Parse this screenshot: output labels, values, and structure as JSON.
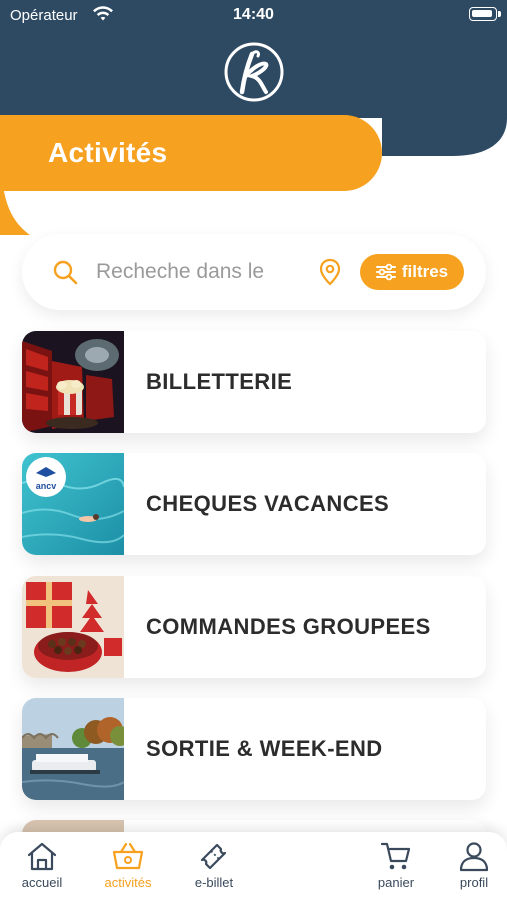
{
  "status_bar": {
    "carrier": "Opérateur",
    "time": "14:40"
  },
  "header": {
    "title": "Activités"
  },
  "search": {
    "placeholder": "Recheche dans le",
    "filter_label": "filtres"
  },
  "categories": [
    {
      "label": "BILLETTERIE"
    },
    {
      "label": "CHEQUES VACANCES",
      "thumb_text": "ancv"
    },
    {
      "label": "COMMANDES GROUPEES"
    },
    {
      "label": "SORTIE & WEEK-END"
    }
  ],
  "tabbar": {
    "items": [
      {
        "label": "accueil",
        "icon": "home-icon"
      },
      {
        "label": "activités",
        "icon": "basket-icon",
        "active": true
      },
      {
        "label": "e-billet",
        "icon": "ticket-icon"
      },
      {
        "label": "panier",
        "icon": "cart-icon"
      },
      {
        "label": "profil",
        "icon": "user-icon"
      }
    ]
  },
  "colors": {
    "navy": "#2e4a63",
    "orange": "#f6a11f",
    "text": "#2c2c2c",
    "tab_inactive": "#3a4a5c"
  }
}
